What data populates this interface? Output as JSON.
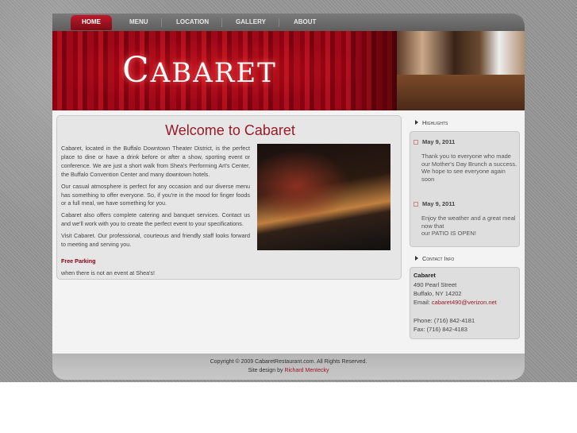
{
  "nav": {
    "items": [
      "HOME",
      "MENU",
      "LOCATION",
      "GALLERY",
      "ABOUT"
    ]
  },
  "banner": {
    "logo": "Cabaret"
  },
  "main": {
    "title": "Welcome to Cabaret",
    "paragraphs": [
      "Cabaret, located in the Buffalo Downtown Theater District, is the perfect place to dine or have a drink before or after a show, sporting event or conference. We are just a short walk from Shea's Performing Art's Center, the Buffalo Convention Center and many downtown hotels.",
      "Our casual atmosphere is perfect for any occasion and our diverse menu has something to offer everyone. So, if you're in the mood for finger foods or a full meal, we have something for you.",
      "Cabaret also offers complete catering and banquet services. Contact us and we'll work with you to create the perfect event to your specifications.",
      "Visit Cabaret. Our professional, courteous and friendly staff looks forward to meeting and serving you."
    ],
    "free_parking": "Free Parking",
    "parking_note": "when there is not an event at Shea's!"
  },
  "sidebar": {
    "highlights_title": "Highlights",
    "highlights": [
      {
        "date": "May 9, 2011",
        "text": "Thank you to everyone who made our Mother's Day Brunch a success. We hope to see everyone again soon"
      },
      {
        "date": "May 9, 2011",
        "text1": "Enjoy the weather and a great meal now that",
        "text2": "our PATIO IS OPEN!"
      }
    ],
    "contact_title": "Contact Info",
    "contact": {
      "name": "Cabaret",
      "street": "490 Pearl Street",
      "city": "Buffalo, NY 14202",
      "email_label": "Email: ",
      "email": "cabaret490@verizon.net",
      "phone": "Phone: (716) 842-4181",
      "fax": "Fax: (716) 842-4183"
    }
  },
  "footer": {
    "copyright": "Copyright © 2009 CabaretRestaurant.com. All Rights Reserved.",
    "design_label": "Site design by ",
    "designer": "Richard Mentecky"
  }
}
